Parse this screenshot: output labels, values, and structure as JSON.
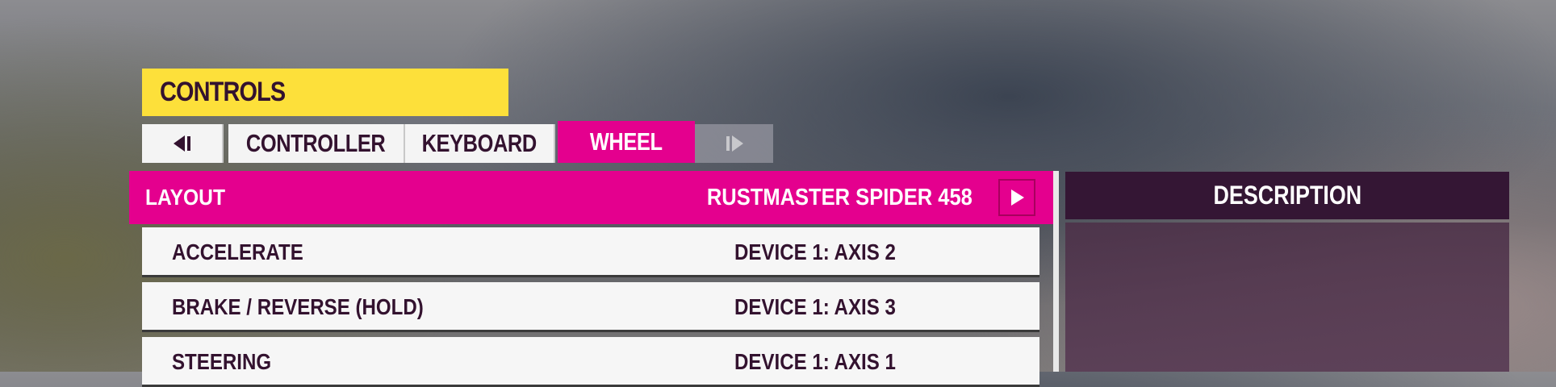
{
  "header": {
    "title": "CONTROLS"
  },
  "tabs": {
    "prev_icon": "bumper-left-icon",
    "items": [
      {
        "label": "CONTROLLER",
        "active": false
      },
      {
        "label": "KEYBOARD",
        "active": false
      },
      {
        "label": "WHEEL",
        "active": true
      }
    ],
    "next_icon": "bumper-right-icon"
  },
  "layout": {
    "label": "LAYOUT",
    "value": "RUSTMASTER SPIDER 458",
    "next_icon": "play-arrow-icon"
  },
  "bindings": [
    {
      "action": "ACCELERATE",
      "binding": "DEVICE 1: AXIS 2"
    },
    {
      "action": "BRAKE / REVERSE (HOLD)",
      "binding": "DEVICE 1: AXIS 3"
    },
    {
      "action": "STEERING",
      "binding": "DEVICE 1: AXIS 1"
    }
  ],
  "description": {
    "title": "DESCRIPTION"
  },
  "colors": {
    "accent": "#e4008e",
    "title_yellow": "#fde03a",
    "dark_plum": "#33122f",
    "row_bg": "#f6f6f6"
  }
}
